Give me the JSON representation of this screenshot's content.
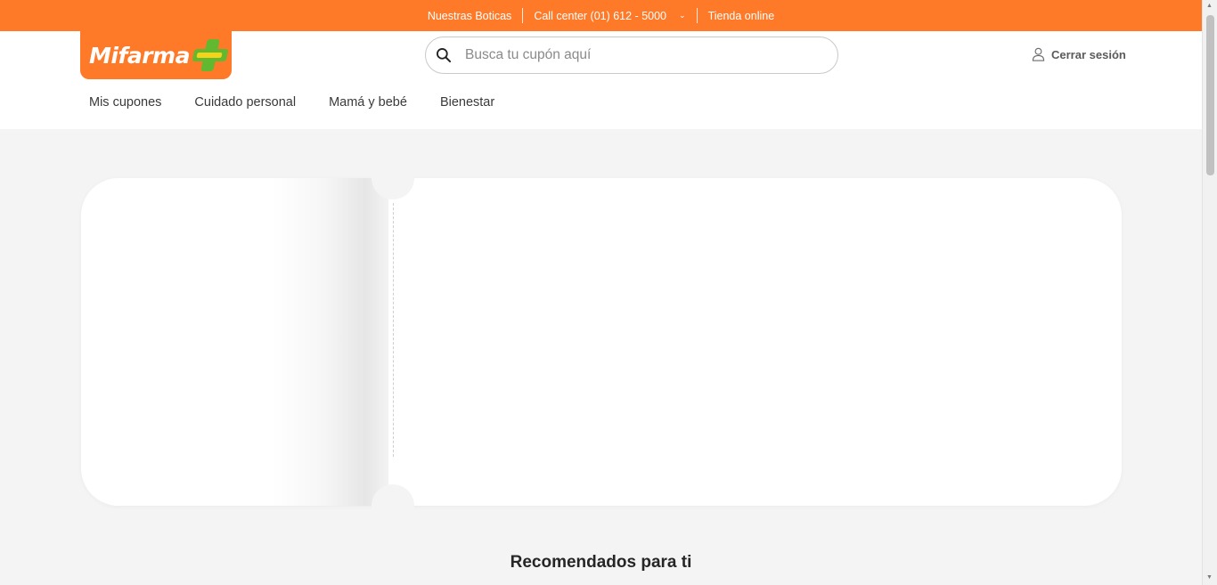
{
  "topbar": {
    "stores": "Nuestras Boticas",
    "call_center": "Call center (01) 612 - 5000",
    "online_store": "Tienda online"
  },
  "brand": {
    "name": "Mifarma",
    "accent_color": "#ff7a28",
    "cross_color": "#62b82f"
  },
  "search": {
    "placeholder": "Busca tu cupón aquí",
    "value": ""
  },
  "account": {
    "logout_label": "Cerrar sesión",
    "icon": "user-icon"
  },
  "nav": {
    "items": [
      {
        "label": "Mis cupones"
      },
      {
        "label": "Cuidado personal"
      },
      {
        "label": "Mamá y bebé"
      },
      {
        "label": "Bienestar"
      }
    ]
  },
  "main": {
    "recommended_title": "Recomendados para ti"
  }
}
